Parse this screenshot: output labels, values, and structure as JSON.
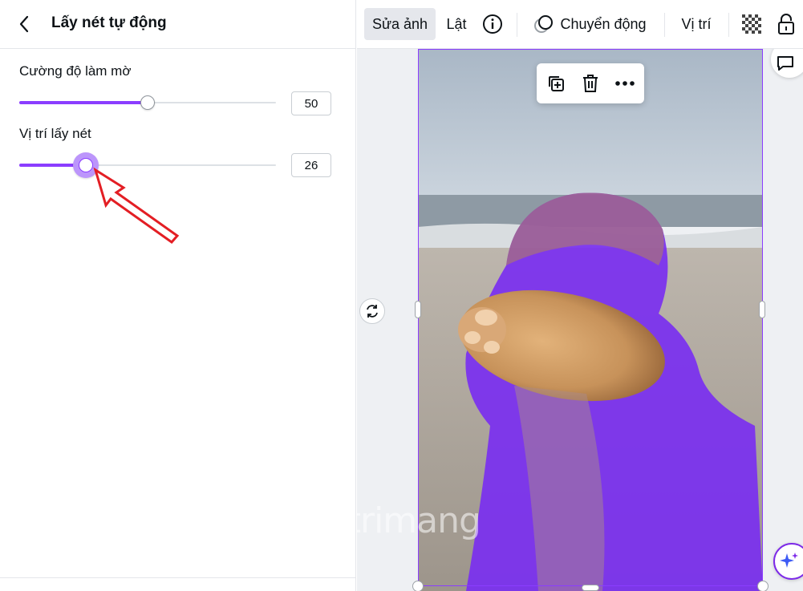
{
  "panel": {
    "title": "Lấy nét tự động",
    "controls": [
      {
        "label": "Cường độ làm mờ",
        "value": "50",
        "level": 0.5
      },
      {
        "label": "Vị trí lấy nét",
        "value": "26",
        "level": 0.26
      }
    ]
  },
  "toolbar": {
    "edit_photo": "Sửa ảnh",
    "flip": "Lật",
    "animate": "Chuyển động",
    "position": "Vị trí"
  },
  "watermark": {
    "text": "uantrimang"
  },
  "colors": {
    "accent": "#8b3dff",
    "arrow": "#e31e24"
  },
  "icons": [
    "back-chevron-icon",
    "info-icon",
    "animate-icon",
    "transparency-icon",
    "lock-icon",
    "duplicate-icon",
    "trash-icon",
    "more-icon",
    "rotate-icon",
    "comment-icon",
    "magic-sparkle-icon"
  ]
}
